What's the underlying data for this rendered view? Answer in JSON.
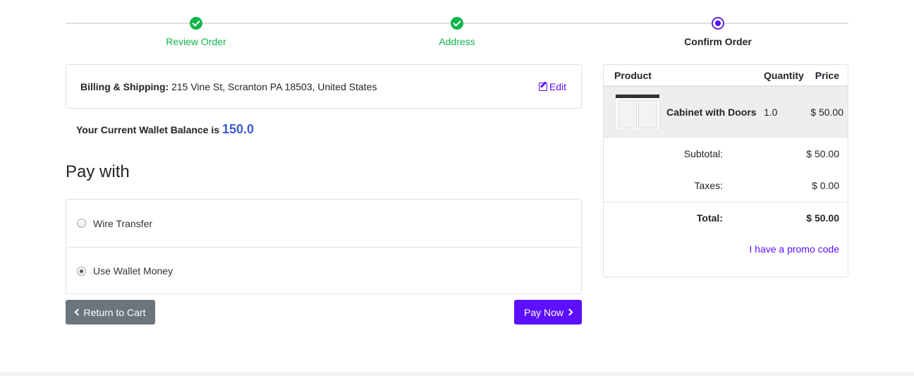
{
  "wizard": {
    "steps": [
      {
        "label": "Review Order",
        "state": "done"
      },
      {
        "label": "Address",
        "state": "done"
      },
      {
        "label": "Confirm Order",
        "state": "current"
      }
    ]
  },
  "address": {
    "label": "Billing & Shipping:",
    "value": "215 Vine St, Scranton PA 18503, United States",
    "edit_label": "Edit"
  },
  "wallet": {
    "text": "Your Current Wallet Balance is",
    "amount": "150.0"
  },
  "payment": {
    "heading": "Pay with",
    "options": [
      {
        "label": "Wire Transfer",
        "selected": false
      },
      {
        "label": "Use Wallet Money",
        "selected": true
      }
    ]
  },
  "buttons": {
    "back_label": "Return to Cart",
    "pay_label": "Pay Now"
  },
  "summary": {
    "headers": {
      "product": "Product",
      "quantity": "Quantity",
      "price": "Price"
    },
    "items": [
      {
        "name": "Cabinet with Doors",
        "quantity": "1.0",
        "price": "$ 50.00"
      }
    ],
    "subtotal_label": "Subtotal:",
    "subtotal": "$ 50.00",
    "taxes_label": "Taxes:",
    "taxes": "$ 0.00",
    "total_label": "Total:",
    "total": "$ 50.00",
    "promo_label": "I have a promo code"
  },
  "colors": {
    "accent": "#5c10ff",
    "success": "#10b54b",
    "secondary": "#6c757d",
    "wallet_amount": "#3b5bd6"
  }
}
